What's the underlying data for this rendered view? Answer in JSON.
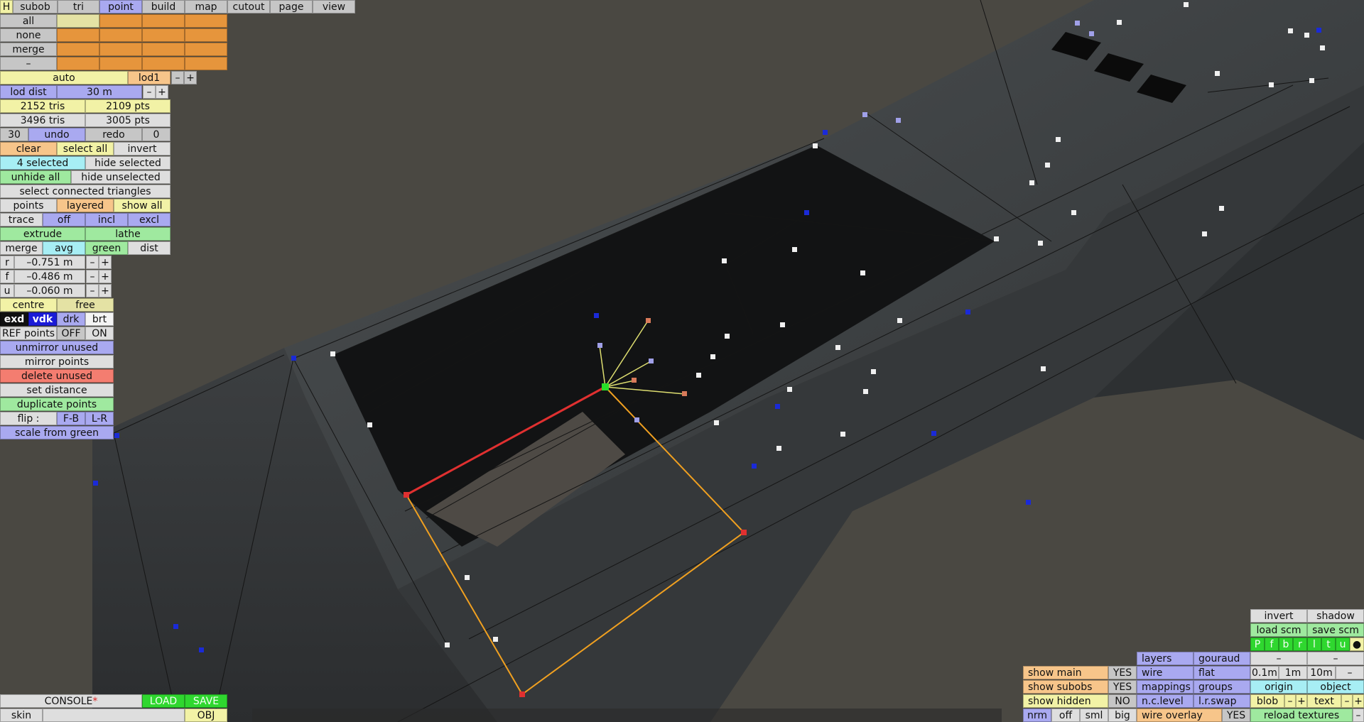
{
  "menu": {
    "items": [
      {
        "label": "H",
        "style": "yel"
      },
      {
        "label": "subob",
        "style": "gray"
      },
      {
        "label": "tri",
        "style": "gray"
      },
      {
        "label": "point",
        "style": "blue"
      },
      {
        "label": "build",
        "style": "gray"
      },
      {
        "label": "map",
        "style": "gray"
      },
      {
        "label": "cutout",
        "style": "gray"
      },
      {
        "label": "page",
        "style": "gray"
      },
      {
        "label": "view",
        "style": "gray"
      }
    ]
  },
  "selection_sets": {
    "rows": [
      "all",
      "none",
      "merge",
      "–"
    ]
  },
  "lod": {
    "auto": "auto",
    "level": "lod1",
    "minus": "–",
    "plus": "+",
    "dist_label": "lod dist",
    "dist_value": "30 m"
  },
  "stats": {
    "tris_1": "2152 tris",
    "pts_1": "2109 pts",
    "tris_2": "3496 tris",
    "pts_2": "3005 pts"
  },
  "undo": {
    "count": "30",
    "undo": "undo",
    "redo": "redo",
    "redo_count": "0"
  },
  "select": {
    "clear": "clear",
    "select_all": "select all",
    "invert": "invert",
    "selected": "4 selected",
    "hide_selected": "hide selected",
    "unhide_all": "unhide all",
    "hide_unselected": "hide unselected",
    "connected": "select connected triangles"
  },
  "points_mode": {
    "points": "points",
    "layered": "layered",
    "show_all": "show all"
  },
  "trace": {
    "label": "trace",
    "off": "off",
    "incl": "incl",
    "excl": "excl"
  },
  "build": {
    "extrude": "extrude",
    "lathe": "lathe"
  },
  "merge_row": {
    "merge": "merge",
    "avg": "avg",
    "green": "green",
    "dist": "dist"
  },
  "coords": [
    {
      "axis": "r",
      "value": "–0.751 m"
    },
    {
      "axis": "f",
      "value": "–0.486 m"
    },
    {
      "axis": "u",
      "value": "–0.060 m"
    }
  ],
  "pivot": {
    "centre": "centre",
    "free": "free"
  },
  "render_modes": {
    "exd": "exd",
    "vdk": "vdk",
    "drk": "drk",
    "brt": "brt"
  },
  "ref_points": {
    "label": "REF points",
    "off": "OFF",
    "on": "ON"
  },
  "actions": {
    "unmirror": "unmirror unused",
    "mirror": "mirror points",
    "delete": "delete unused",
    "set_distance": "set distance",
    "duplicate": "duplicate points",
    "flip_label": "flip :",
    "flip_fb": "F-B",
    "flip_lr": "L-R",
    "scale": "scale from green"
  },
  "console": {
    "label": "CONSOLE",
    "star": "*",
    "load": "LOAD",
    "save": "SAVE",
    "skin": "skin",
    "obj": "OBJ"
  },
  "show_panel": {
    "show_main": "show main",
    "show_main_val": "YES",
    "show_subobs": "show subobs",
    "show_subobs_val": "YES",
    "show_hidden": "show hidden",
    "show_hidden_val": "NO",
    "nrm": "nrm",
    "off": "off",
    "sml": "sml",
    "big": "big"
  },
  "display_panel": {
    "layers": "layers",
    "gouraud": "gouraud",
    "wire": "wire",
    "flat": "flat",
    "mappings": "mappings",
    "groups": "groups",
    "nc_level": "n.c.level",
    "lr_swap": "l.r.swap",
    "wire_overlay": "wire overlay",
    "wire_overlay_val": "YES"
  },
  "scene_panel": {
    "invert": "invert",
    "shadow": "shadow",
    "load_scm": "load scm",
    "save_scm": "save scm",
    "views": [
      "P",
      "f",
      "b",
      "r",
      "l",
      "t",
      "u"
    ],
    "dot": "●",
    "dash1": "–",
    "dash2": "–",
    "g1": "0.1m",
    "g2": "1m",
    "g3": "10m",
    "gminus": "–",
    "origin": "origin",
    "object": "object",
    "blob": "blob",
    "blob_minus": "–",
    "blob_plus": "+",
    "text": "text",
    "text_minus": "–",
    "text_plus": "+",
    "reload": "reload textures",
    "reload_minus": "–"
  },
  "colors": {
    "background": "#4a4842",
    "hull": "#3a3d3f",
    "selection_edge": "#f0a020",
    "active_edge": "#e03030",
    "green_point": "#28e028",
    "blue_point": "#1a2ad8",
    "white_point": "#f0f0f0"
  }
}
